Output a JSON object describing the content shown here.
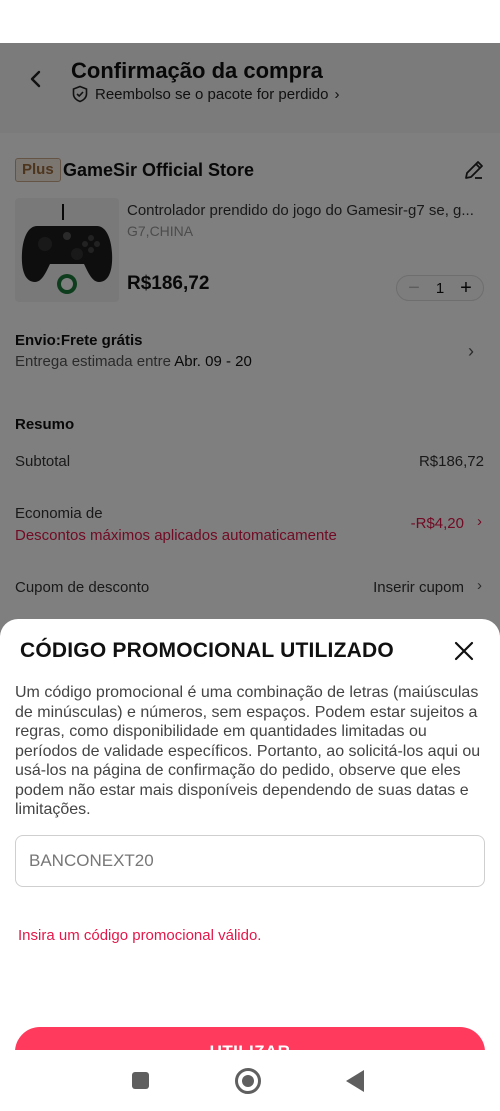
{
  "header": {
    "title": "Confirmação da compra",
    "refund_text": "Reembolso se o pacote for perdido",
    "refund_chevron": "›"
  },
  "store": {
    "plus_badge": "Plus",
    "name": "GameSir Official Store"
  },
  "product": {
    "title": "Controlador prendido do jogo do Gamesir-g7 se, g...",
    "variant": "G7,CHINA",
    "price": "R$186,72",
    "quantity": "1",
    "qty_minus": "−",
    "qty_plus": "+"
  },
  "shipping": {
    "title": "Envio:Frete grátis",
    "eta_prefix": "Entrega estimada entre",
    "eta_dates": "Abr. 09 - 20",
    "chevron": "›"
  },
  "summary": {
    "title": "Resumo",
    "subtotal_label": "Subtotal",
    "subtotal_value": "R$186,72",
    "savings_label": "Economia de",
    "savings_note": "Descontos máximos aplicados automaticamente",
    "savings_value": "-R$4,20",
    "savings_chevron": "›",
    "coupon_label": "Cupom de desconto",
    "coupon_value": "Inserir cupom",
    "coupon_chevron": "›"
  },
  "promo_sheet": {
    "title": "CÓDIGO PROMOCIONAL UTILIZADO",
    "description": "Um código promocional é uma combinação de letras (maiúsculas de minúsculas) e números, sem espaços. Podem estar sujeitos a regras, como disponibilidade em quantidades limitadas ou períodos de validade específicos. Portanto, ao solicitá-los aqui ou usá-los na página de confirmação do pedido, observe que eles podem não estar mais disponíveis dependendo de suas datas e limitações.",
    "input_value": "BANCONEXT20",
    "error": "Insira um código promocional válido.",
    "button_label": "UTILIZAR"
  },
  "colors": {
    "accent": "#ff3a5c",
    "error": "#e3174a"
  },
  "icons": [
    "back-arrow-icon",
    "shield-refund-icon",
    "edit-pencil-icon",
    "close-icon",
    "nav-recents-icon",
    "nav-home-icon",
    "nav-back-icon"
  ]
}
